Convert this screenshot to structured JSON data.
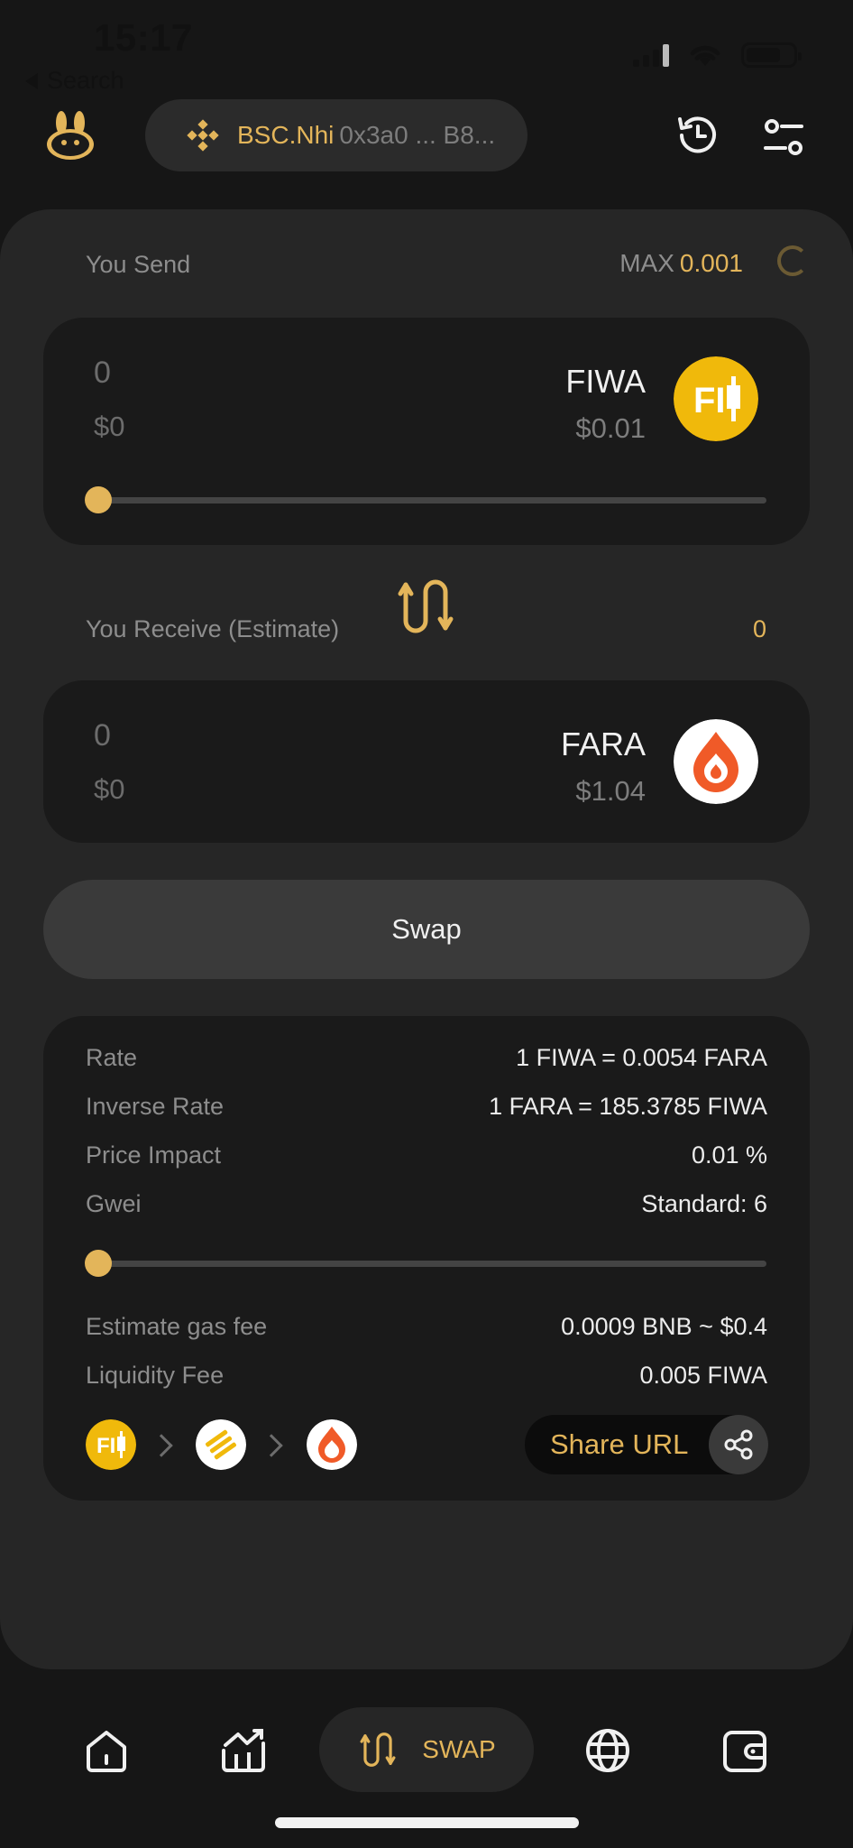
{
  "status_bar": {
    "time": "15:17",
    "back_label": "Search"
  },
  "header": {
    "wallet_name": "BSC.Nhi",
    "wallet_address": "0x3a0 ... B8..."
  },
  "send": {
    "label": "You Send",
    "max_label": "MAX",
    "max_value": "0.001",
    "amount": "0",
    "amount_usd": "$0",
    "token": "FIWA",
    "token_price": "$0.01",
    "slider_fraction": 0
  },
  "receive": {
    "label": "You Receive (Estimate)",
    "estimate": "0",
    "amount": "0",
    "amount_usd": "$0",
    "token": "FARA",
    "token_price": "$1.04"
  },
  "swap_button": "Swap",
  "info": {
    "rows_top": [
      {
        "key": "Rate",
        "value": "1 FIWA = 0.0054 FARA"
      },
      {
        "key": "Inverse Rate",
        "value": "1 FARA = 185.3785 FIWA"
      },
      {
        "key": "Price Impact",
        "value": "0.01 %"
      },
      {
        "key": "Gwei",
        "value": "Standard: 6"
      }
    ],
    "gwei_slider_fraction": 0,
    "rows_bottom": [
      {
        "key": "Estimate gas fee",
        "value": "0.0009 BNB ~ $0.4"
      },
      {
        "key": "Liquidity Fee",
        "value": "0.005 FIWA"
      }
    ],
    "route_icons": [
      "fiwa-coin-icon",
      "bnb-coin-icon",
      "fara-coin-icon"
    ],
    "share_label": "Share URL"
  },
  "nav": {
    "active_label": "SWAP",
    "items": [
      "home-icon",
      "market-chart-icon",
      "swap-icon",
      "globe-icon",
      "wallet-icon"
    ]
  },
  "colors": {
    "accent": "#e3b55a",
    "background": "#161616",
    "panel": "#262626",
    "card": "#1a1a1a",
    "fiwa_coin": "#f0b90b",
    "fara_coin": "#f05a28"
  }
}
